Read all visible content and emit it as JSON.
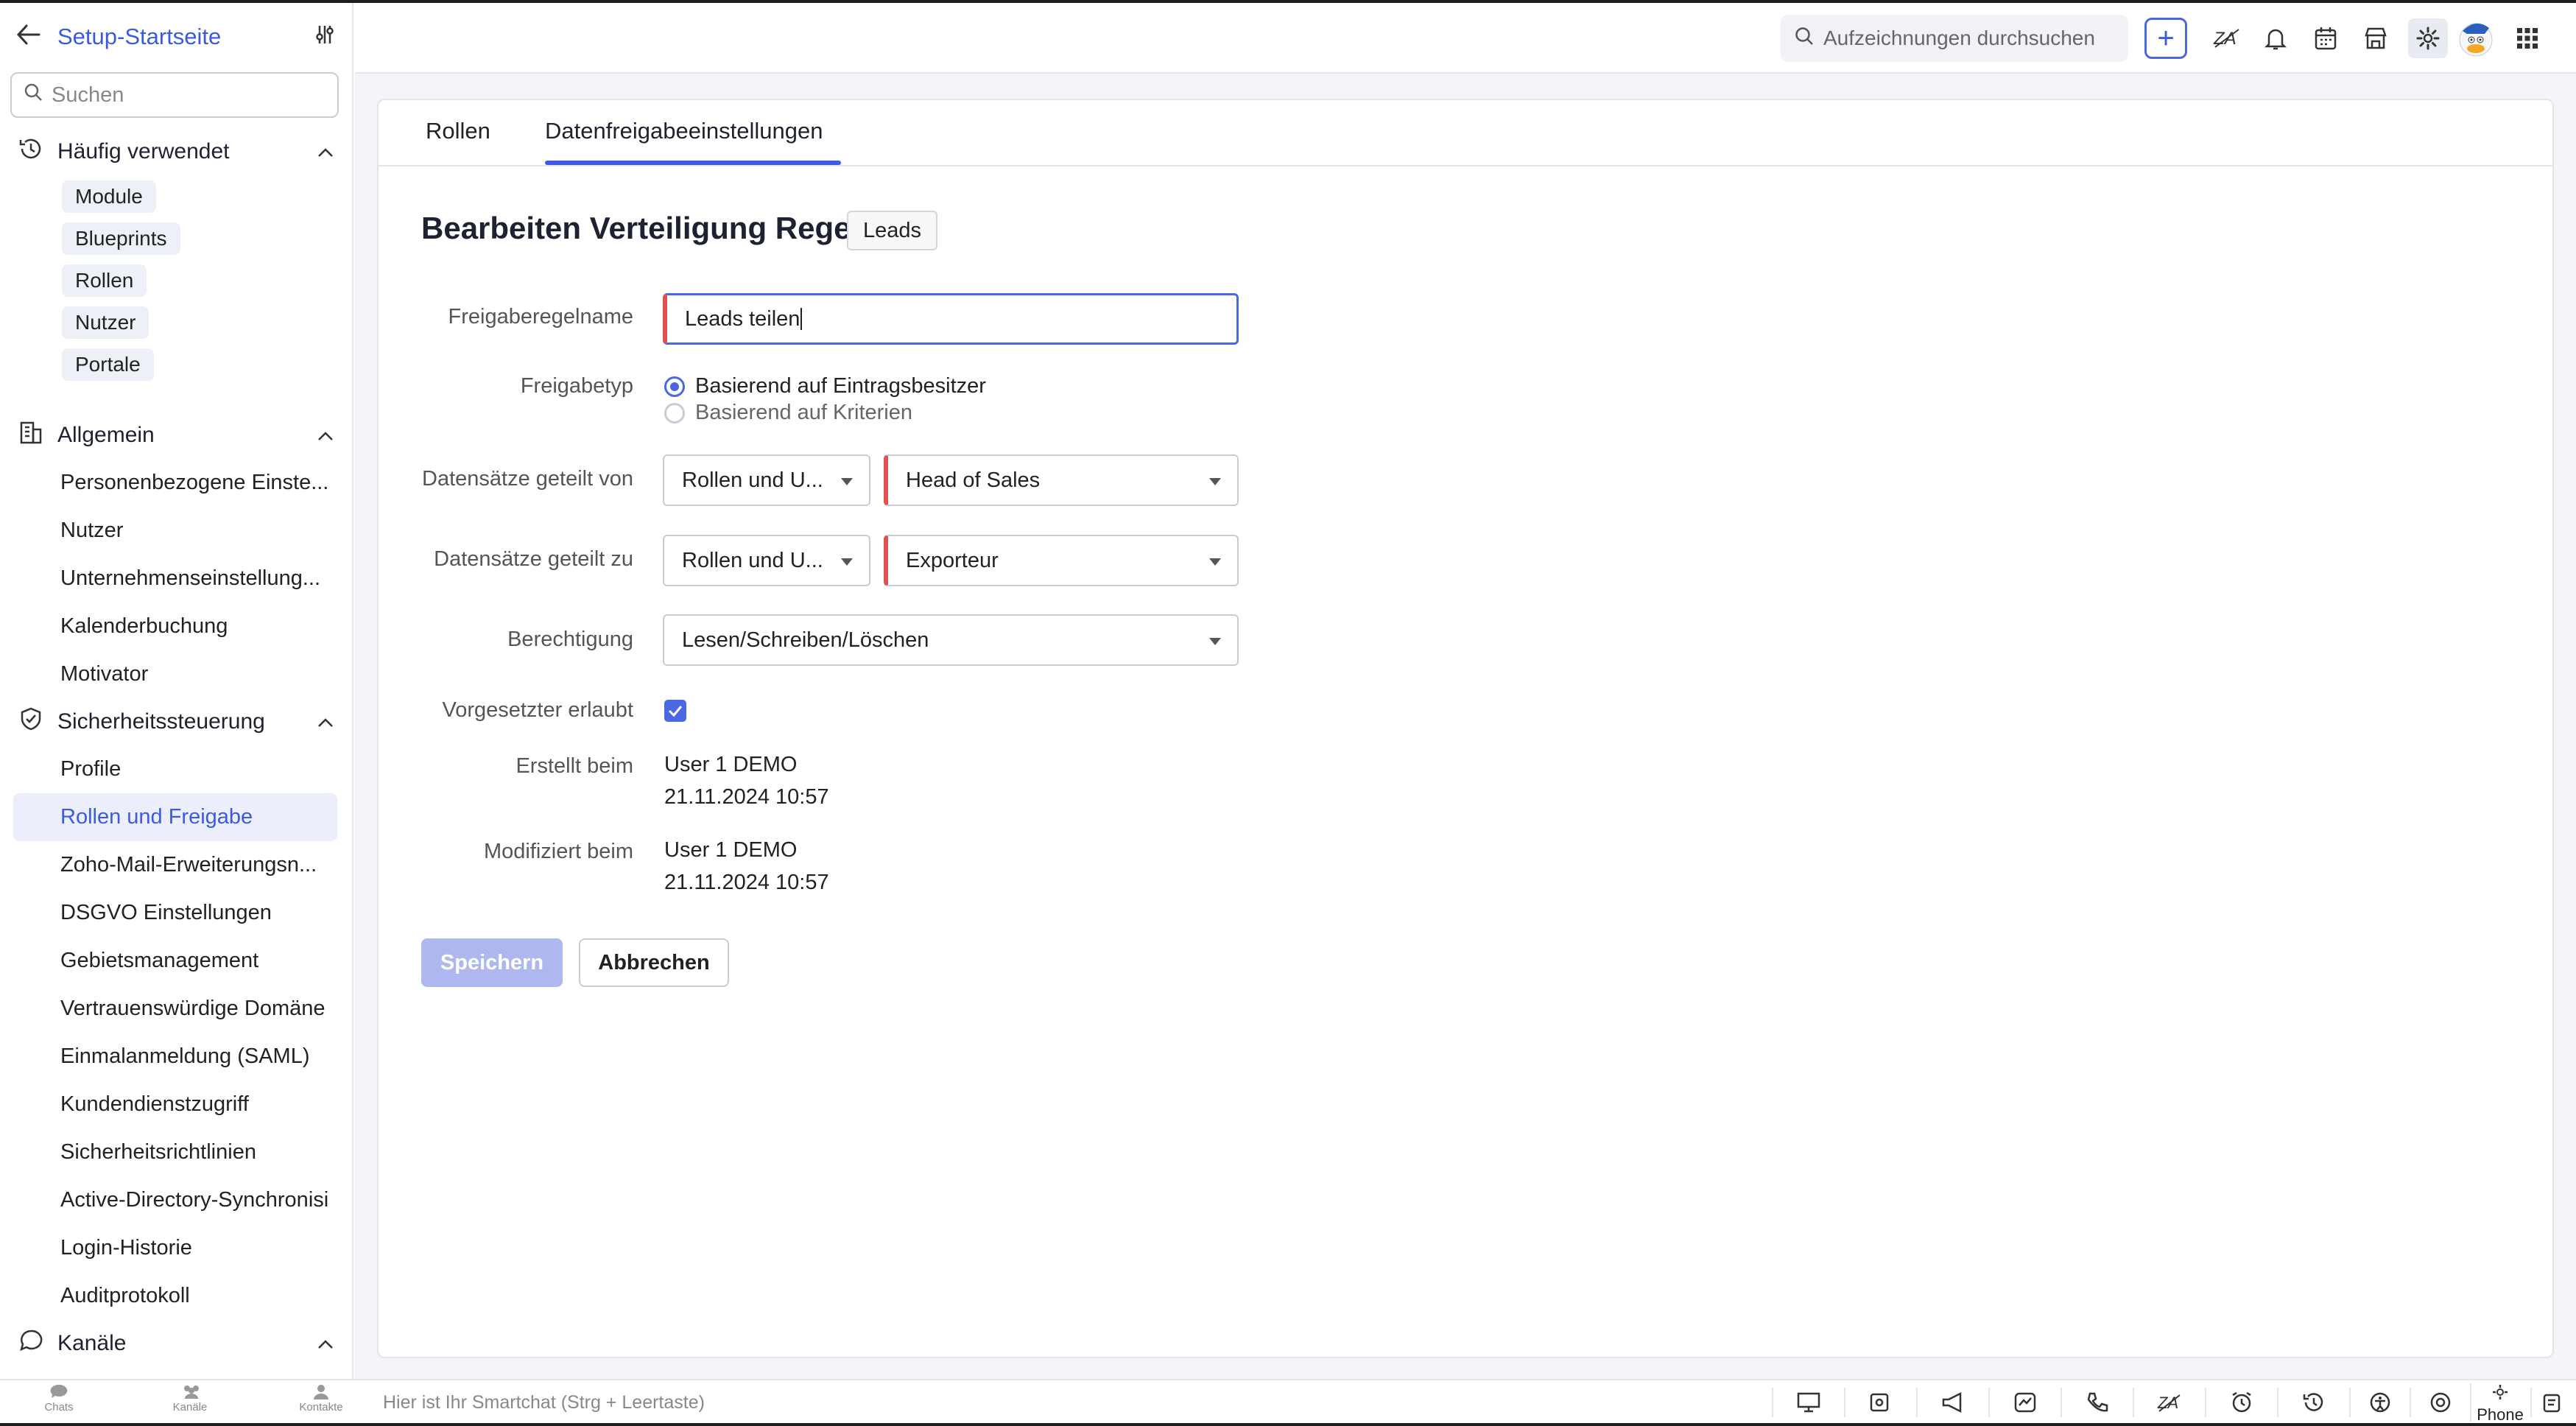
{
  "sidebar": {
    "title": "Setup-Startseite",
    "search_placeholder": "Suchen",
    "sections": {
      "frequent": {
        "label": "Häufig verwendet",
        "chips": [
          "Module",
          "Blueprints",
          "Rollen",
          "Nutzer",
          "Portale"
        ]
      },
      "general": {
        "label": "Allgemein",
        "items": [
          "Personenbezogene Einste...",
          "Nutzer",
          "Unternehmenseinstellung...",
          "Kalenderbuchung",
          "Motivator"
        ]
      },
      "security": {
        "label": "Sicherheitssteuerung",
        "items": [
          "Profile",
          "Rollen und Freigabe",
          "Zoho-Mail-Erweiterungsn...",
          "DSGVO Einstellungen",
          "Gebietsmanagement",
          "Vertrauenswürdige Domäne",
          "Einmalanmeldung (SAML)",
          "Kundendienstzugriff",
          "Sicherheitsrichtlinien",
          "Active-Directory-Synchronisi",
          "Login-Historie",
          "Auditprotokoll"
        ]
      },
      "channels": {
        "label": "Kanäle"
      }
    }
  },
  "topbar": {
    "search_placeholder": "Aufzeichnungen durchsuchen",
    "add_label": "+"
  },
  "tabs": [
    "Rollen",
    "Datenfreigabeeinstellungen"
  ],
  "form": {
    "heading": "Bearbeiten Verteiligung Regel",
    "module_tag": "Leads",
    "rule_name_label": "Freigaberegelname",
    "rule_name_value": "Leads teilen",
    "share_type_label": "Freigabetyp",
    "share_type_options": [
      "Basierend auf Eintragsbesitzer",
      "Basierend auf Kriterien"
    ],
    "share_type_selected": 0,
    "shared_from_label": "Datensätze geteilt von",
    "shared_from_type": "Rollen und U...",
    "shared_from_value": "Head of Sales",
    "shared_to_label": "Datensätze geteilt zu",
    "shared_to_type": "Rollen und U...",
    "shared_to_value": "Exporteur",
    "permission_label": "Berechtigung",
    "permission_value": "Lesen/Schreiben/Löschen",
    "superior_label": "Vorgesetzter erlaubt",
    "superior_checked": true,
    "created_label": "Erstellt beim",
    "created_user": "User 1 DEMO",
    "created_date": "21.11.2024 10:57",
    "modified_label": "Modifiziert beim",
    "modified_user": "User 1 DEMO",
    "modified_date": "21.11.2024 10:57",
    "save_label": "Speichern",
    "cancel_label": "Abbrechen"
  },
  "bottombar": {
    "nav": [
      "Chats",
      "Kanäle",
      "Kontakte"
    ],
    "smartchat_placeholder": "Hier ist Ihr Smartchat (Strg + Leertaste)",
    "phone_label": "Phone"
  },
  "colors": {
    "accent": "#3b5bdb",
    "required": "#e0524f",
    "save_disabled": "#aeb8ee"
  }
}
